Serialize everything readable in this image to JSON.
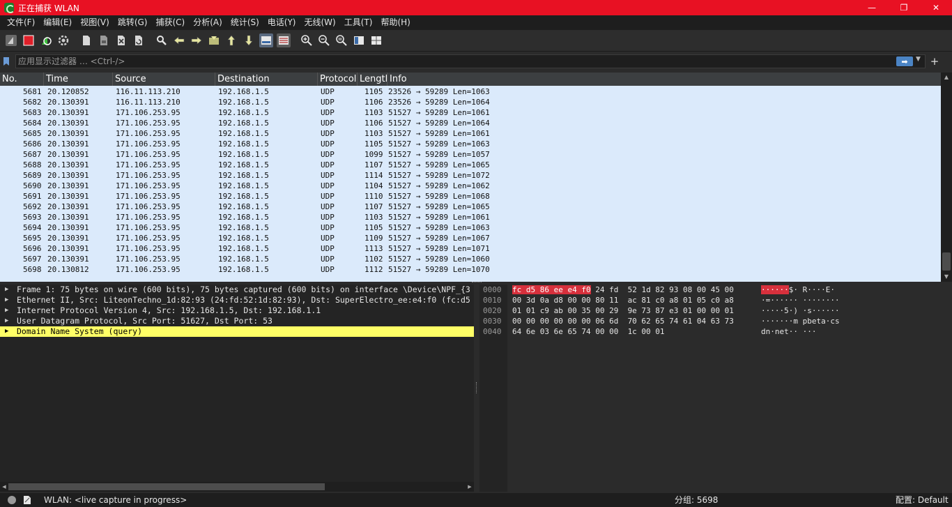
{
  "window": {
    "title": "正在捕获 WLAN",
    "minimize": "—",
    "restore": "❐",
    "close": "✕"
  },
  "menu": [
    "文件(F)",
    "编辑(E)",
    "视图(V)",
    "跳转(G)",
    "捕获(C)",
    "分析(A)",
    "统计(S)",
    "电话(Y)",
    "无线(W)",
    "工具(T)",
    "帮助(H)"
  ],
  "filter": {
    "placeholder": "应用显示过滤器 … <Ctrl-/>",
    "apply_glyph": "➡",
    "dropdown_glyph": "▼",
    "add_glyph": "+"
  },
  "packet_list": {
    "columns": [
      "No.",
      "Time",
      "Source",
      "Destination",
      "Protocol",
      "Lengtl",
      "Info"
    ],
    "rows": [
      {
        "no": "5681",
        "time": "20.120852",
        "src": "116.11.113.210",
        "dst": "192.168.1.5",
        "proto": "UDP",
        "len": "1105",
        "info": "23526 → 59289 Len=1063"
      },
      {
        "no": "5682",
        "time": "20.130391",
        "src": "116.11.113.210",
        "dst": "192.168.1.5",
        "proto": "UDP",
        "len": "1106",
        "info": "23526 → 59289 Len=1064"
      },
      {
        "no": "5683",
        "time": "20.130391",
        "src": "171.106.253.95",
        "dst": "192.168.1.5",
        "proto": "UDP",
        "len": "1103",
        "info": "51527 → 59289 Len=1061"
      },
      {
        "no": "5684",
        "time": "20.130391",
        "src": "171.106.253.95",
        "dst": "192.168.1.5",
        "proto": "UDP",
        "len": "1106",
        "info": "51527 → 59289 Len=1064"
      },
      {
        "no": "5685",
        "time": "20.130391",
        "src": "171.106.253.95",
        "dst": "192.168.1.5",
        "proto": "UDP",
        "len": "1103",
        "info": "51527 → 59289 Len=1061"
      },
      {
        "no": "5686",
        "time": "20.130391",
        "src": "171.106.253.95",
        "dst": "192.168.1.5",
        "proto": "UDP",
        "len": "1105",
        "info": "51527 → 59289 Len=1063"
      },
      {
        "no": "5687",
        "time": "20.130391",
        "src": "171.106.253.95",
        "dst": "192.168.1.5",
        "proto": "UDP",
        "len": "1099",
        "info": "51527 → 59289 Len=1057"
      },
      {
        "no": "5688",
        "time": "20.130391",
        "src": "171.106.253.95",
        "dst": "192.168.1.5",
        "proto": "UDP",
        "len": "1107",
        "info": "51527 → 59289 Len=1065"
      },
      {
        "no": "5689",
        "time": "20.130391",
        "src": "171.106.253.95",
        "dst": "192.168.1.5",
        "proto": "UDP",
        "len": "1114",
        "info": "51527 → 59289 Len=1072"
      },
      {
        "no": "5690",
        "time": "20.130391",
        "src": "171.106.253.95",
        "dst": "192.168.1.5",
        "proto": "UDP",
        "len": "1104",
        "info": "51527 → 59289 Len=1062"
      },
      {
        "no": "5691",
        "time": "20.130391",
        "src": "171.106.253.95",
        "dst": "192.168.1.5",
        "proto": "UDP",
        "len": "1110",
        "info": "51527 → 59289 Len=1068"
      },
      {
        "no": "5692",
        "time": "20.130391",
        "src": "171.106.253.95",
        "dst": "192.168.1.5",
        "proto": "UDP",
        "len": "1107",
        "info": "51527 → 59289 Len=1065"
      },
      {
        "no": "5693",
        "time": "20.130391",
        "src": "171.106.253.95",
        "dst": "192.168.1.5",
        "proto": "UDP",
        "len": "1103",
        "info": "51527 → 59289 Len=1061"
      },
      {
        "no": "5694",
        "time": "20.130391",
        "src": "171.106.253.95",
        "dst": "192.168.1.5",
        "proto": "UDP",
        "len": "1105",
        "info": "51527 → 59289 Len=1063"
      },
      {
        "no": "5695",
        "time": "20.130391",
        "src": "171.106.253.95",
        "dst": "192.168.1.5",
        "proto": "UDP",
        "len": "1109",
        "info": "51527 → 59289 Len=1067"
      },
      {
        "no": "5696",
        "time": "20.130391",
        "src": "171.106.253.95",
        "dst": "192.168.1.5",
        "proto": "UDP",
        "len": "1113",
        "info": "51527 → 59289 Len=1071"
      },
      {
        "no": "5697",
        "time": "20.130391",
        "src": "171.106.253.95",
        "dst": "192.168.1.5",
        "proto": "UDP",
        "len": "1102",
        "info": "51527 → 59289 Len=1060"
      },
      {
        "no": "5698",
        "time": "20.130812",
        "src": "171.106.253.95",
        "dst": "192.168.1.5",
        "proto": "UDP",
        "len": "1112",
        "info": "51527 → 59289 Len=1070"
      }
    ]
  },
  "details": {
    "items": [
      {
        "arrow": "▶",
        "text": "Frame 1: 75 bytes on wire (600 bits), 75 bytes captured (600 bits) on interface \\Device\\NPF_{3"
      },
      {
        "arrow": "▶",
        "text": "Ethernet II, Src: LiteonTechno_1d:82:93 (24:fd:52:1d:82:93), Dst: SuperElectro_ee:e4:f0 (fc:d5"
      },
      {
        "arrow": "▶",
        "text": "Internet Protocol Version 4, Src: 192.168.1.5, Dst: 192.168.1.1"
      },
      {
        "arrow": "▶",
        "text": "User Datagram Protocol, Src Port: 51627, Dst Port: 53"
      },
      {
        "arrow": "▶",
        "text": "Domain Name System (query)",
        "selected": true
      }
    ]
  },
  "bytes": {
    "offsets": [
      "0000",
      "0010",
      "0020",
      "0030",
      "0040"
    ],
    "rows": [
      {
        "hex_hl": "fc d5 86 ee e4 f0",
        "hex": " 24 fd  52 1d 82 93 08 00 45 00",
        "ascii_hl": "······",
        "ascii": "$· R····E·"
      },
      {
        "hex_hl": "",
        "hex": "00 3d 0a d8 00 00 80 11  ac 81 c0 a8 01 05 c0 a8",
        "ascii_hl": "",
        "ascii": "·=······ ········"
      },
      {
        "hex_hl": "",
        "hex": "01 01 c9 ab 00 35 00 29  9e 73 87 e3 01 00 00 01",
        "ascii_hl": "",
        "ascii": "·····5·) ·s······"
      },
      {
        "hex_hl": "",
        "hex": "00 00 00 00 00 00 06 6d  70 62 65 74 61 04 63 73",
        "ascii_hl": "",
        "ascii": "·······m pbeta·cs"
      },
      {
        "hex_hl": "",
        "hex": "64 6e 03 6e 65 74 00 00  1c 00 01",
        "ascii_hl": "",
        "ascii": "dn·net·· ···"
      }
    ]
  },
  "status": {
    "capture": "WLAN: <live capture in progress>",
    "packets": "分组: 5698",
    "profile": "配置: Default"
  },
  "colors": {
    "titlebar": "#e81123",
    "row_bg": "#dbeafb",
    "selected_tree": "#ffff66",
    "byte_highlight": "#d7303c"
  }
}
